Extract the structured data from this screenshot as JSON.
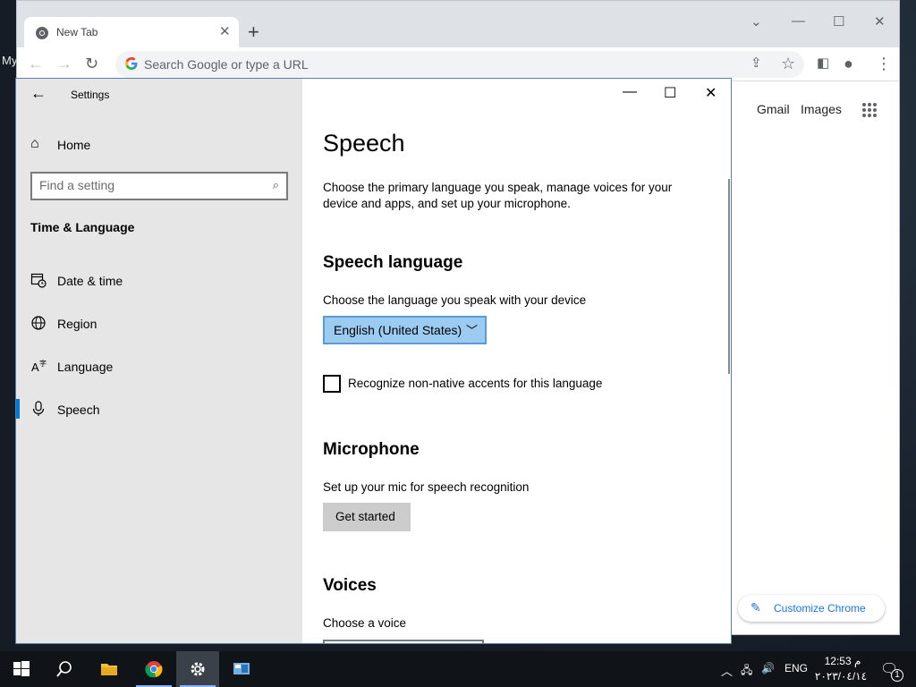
{
  "desktop": {
    "partial_label": "My"
  },
  "chrome": {
    "tab_title": "New Tab",
    "tab_close": "✕",
    "new_tab": "+",
    "window_controls": {
      "list": "⌄",
      "minimize": "—",
      "maximize": "☐",
      "close": "✕"
    },
    "omnibox_placeholder": "Search Google or type a URL",
    "ntp_links": [
      "Gmail",
      "Images"
    ],
    "customize_label": "Customize Chrome"
  },
  "settings": {
    "title": "Settings",
    "home_label": "Home",
    "search_placeholder": "Find a setting",
    "section": "Time & Language",
    "nav_items": [
      {
        "label": "Date & time",
        "icon": "calendar-clock-icon"
      },
      {
        "label": "Region",
        "icon": "globe-icon"
      },
      {
        "label": "Language",
        "icon": "language-icon"
      },
      {
        "label": "Speech",
        "icon": "microphone-icon",
        "selected": true
      }
    ],
    "page_title": "Speech",
    "page_description": "Choose the primary language you speak, manage voices for your device and apps, and set up your microphone.",
    "speech_language": {
      "heading": "Speech language",
      "label": "Choose the language you speak with your device",
      "selected": "English (United States)",
      "accent_checkbox_label": "Recognize non-native accents for this language",
      "accent_checked": false
    },
    "microphone": {
      "heading": "Microphone",
      "label": "Set up your mic for speech recognition",
      "button": "Get started"
    },
    "voices": {
      "heading": "Voices",
      "label": "Choose a voice"
    }
  },
  "taskbar": {
    "tray_lang": "ENG",
    "time": "12:53 م",
    "date": "٢٠٢٣/٠٤/١٤",
    "notification_count": "1",
    "accent_color": "#0078d7"
  }
}
